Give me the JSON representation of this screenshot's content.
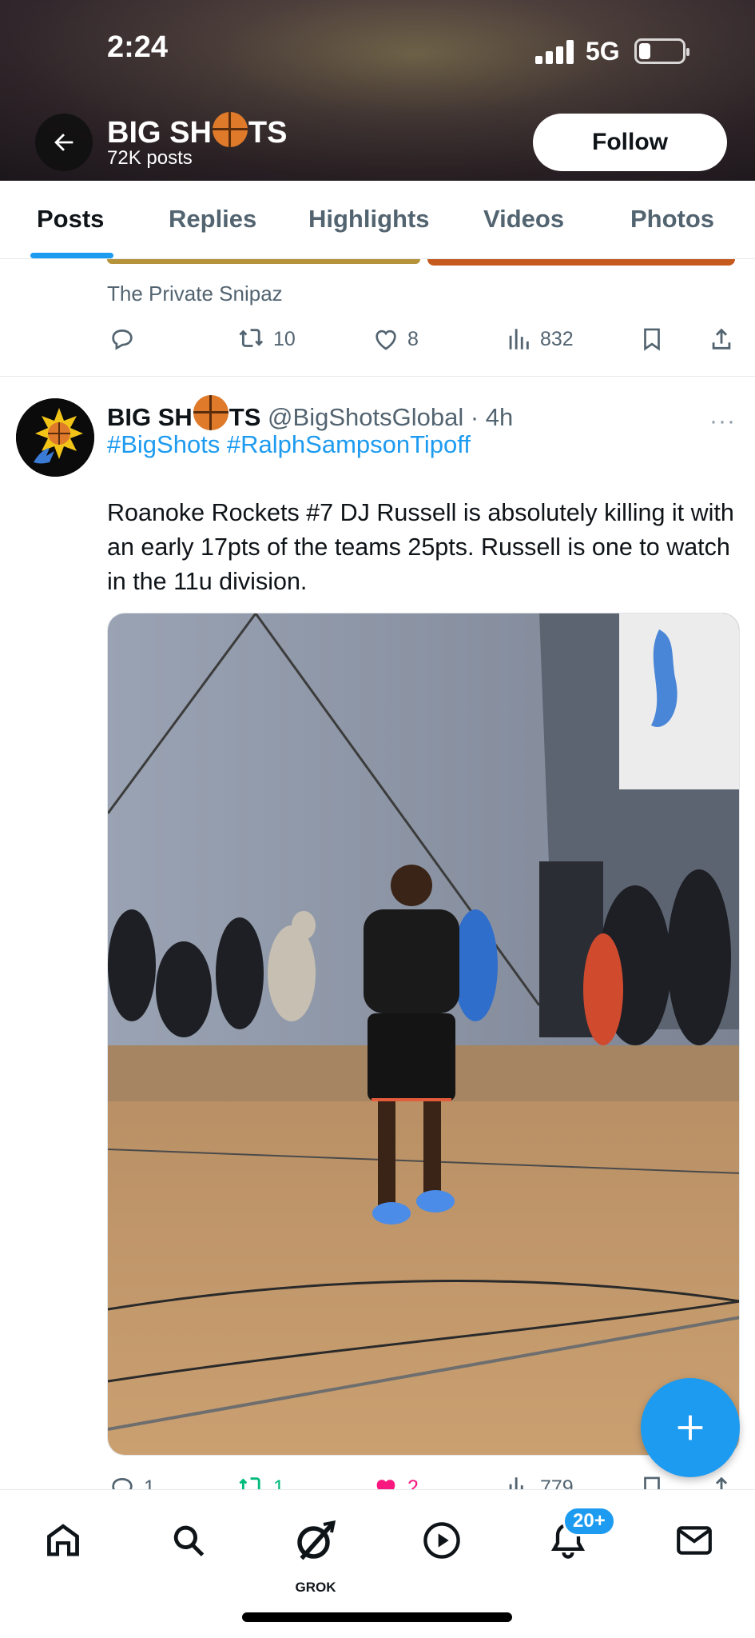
{
  "status_bar": {
    "time": "2:24",
    "network": "5G"
  },
  "header": {
    "name_prefix": "BIG SH",
    "name_suffix": "TS",
    "posts_count": "72K posts",
    "follow_label": "Follow"
  },
  "tabs": [
    {
      "label": "Posts",
      "active": true
    },
    {
      "label": "Replies",
      "active": false
    },
    {
      "label": "Highlights",
      "active": false
    },
    {
      "label": "Videos",
      "active": false
    },
    {
      "label": "Photos",
      "active": false
    }
  ],
  "previous_post": {
    "caption": "The Private Snipaz",
    "retweets": "10",
    "likes": "8",
    "views": "832"
  },
  "tweet": {
    "name_prefix": "BIG SH",
    "name_suffix": "TS",
    "handle": "@BigShotsGlobal",
    "time": "· 4h",
    "more": "···",
    "hashtags": "#BigShots #RalphSampsonTipoff",
    "text": "Roanoke Rockets #7 DJ Russell is absolutely killing it with an early 17pts of the teams 25pts. Russell is one to watch in the 11u division.",
    "replies": "1",
    "retweets": "1",
    "likes": "2",
    "views": "779"
  },
  "bottom_nav": {
    "grok_label": "GROK",
    "notifications_badge": "20+"
  },
  "colors": {
    "accent": "#1d9bf0",
    "muted": "#536471",
    "like": "#f91880",
    "retweet": "#00ba7c"
  }
}
